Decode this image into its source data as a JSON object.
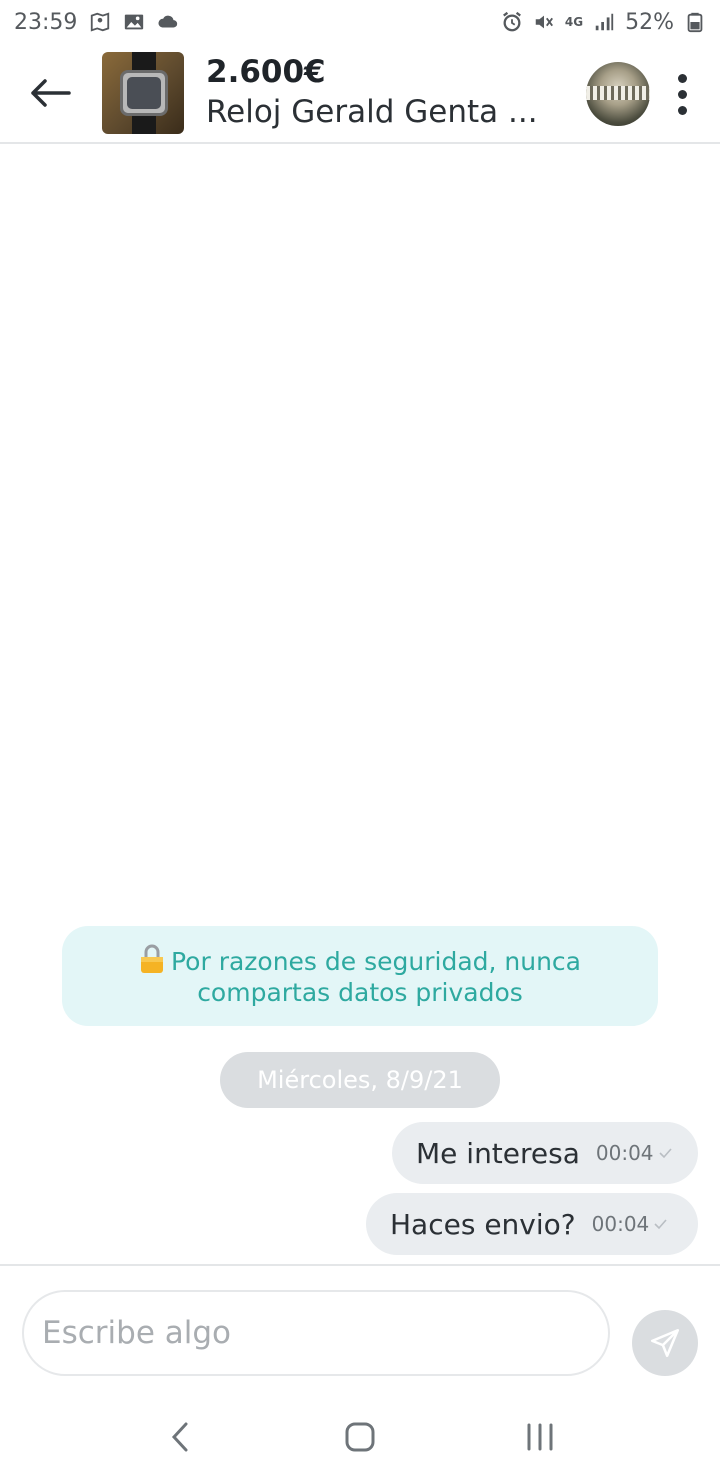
{
  "status_bar": {
    "time": "23:59",
    "battery": "52%",
    "network": "4G",
    "left_icons": [
      "maps-icon",
      "image-icon",
      "cloud-icon"
    ],
    "right_icons": [
      "alarm-icon",
      "mute-icon",
      "signal-icon",
      "battery-icon"
    ]
  },
  "header": {
    "price": "2.600€",
    "title": "Reloj Gerald Genta ..."
  },
  "chat": {
    "safety_notice": "Por razones de seguridad, nunca compartas datos privados",
    "date_label": "Miércoles, 8/9/21",
    "messages": [
      {
        "text": "Me interesa",
        "time": "00:04",
        "status": "sent"
      },
      {
        "text": "Haces envio?",
        "time": "00:04",
        "status": "sent"
      }
    ]
  },
  "composer": {
    "placeholder": "Escribe algo"
  },
  "colors": {
    "accent": "#2ea9a0",
    "banner_bg": "#e3f6f7",
    "bubble_bg": "#eaedf0",
    "chip_bg": "#dadde0"
  }
}
